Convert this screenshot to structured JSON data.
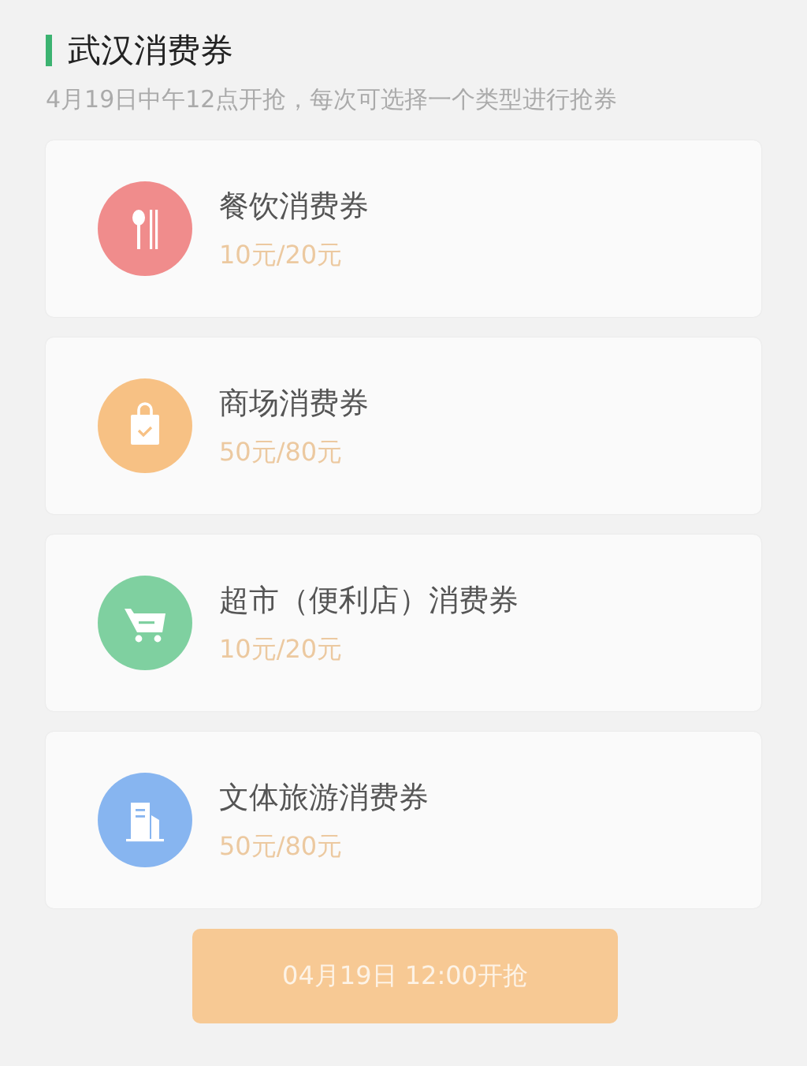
{
  "section": {
    "title": "武汉消费券",
    "subtitle": "4月19日中午12点开抢，每次可选择一个类型进行抢券"
  },
  "coupons": [
    {
      "kind": "dining",
      "color": "#f08c8c",
      "name": "餐饮消费券",
      "amount": "10元/20元"
    },
    {
      "kind": "mall",
      "color": "#f7c184",
      "name": "商场消费券",
      "amount": "50元/80元"
    },
    {
      "kind": "supermarket",
      "color": "#7fd0a0",
      "name": "超市（便利店）消费券",
      "amount": "10元/20元"
    },
    {
      "kind": "culture",
      "color": "#87b5f0",
      "name": "文体旅游消费券",
      "amount": "50元/80元"
    }
  ],
  "button": {
    "label": "04月19日 12:00开抢",
    "disabled": true
  }
}
